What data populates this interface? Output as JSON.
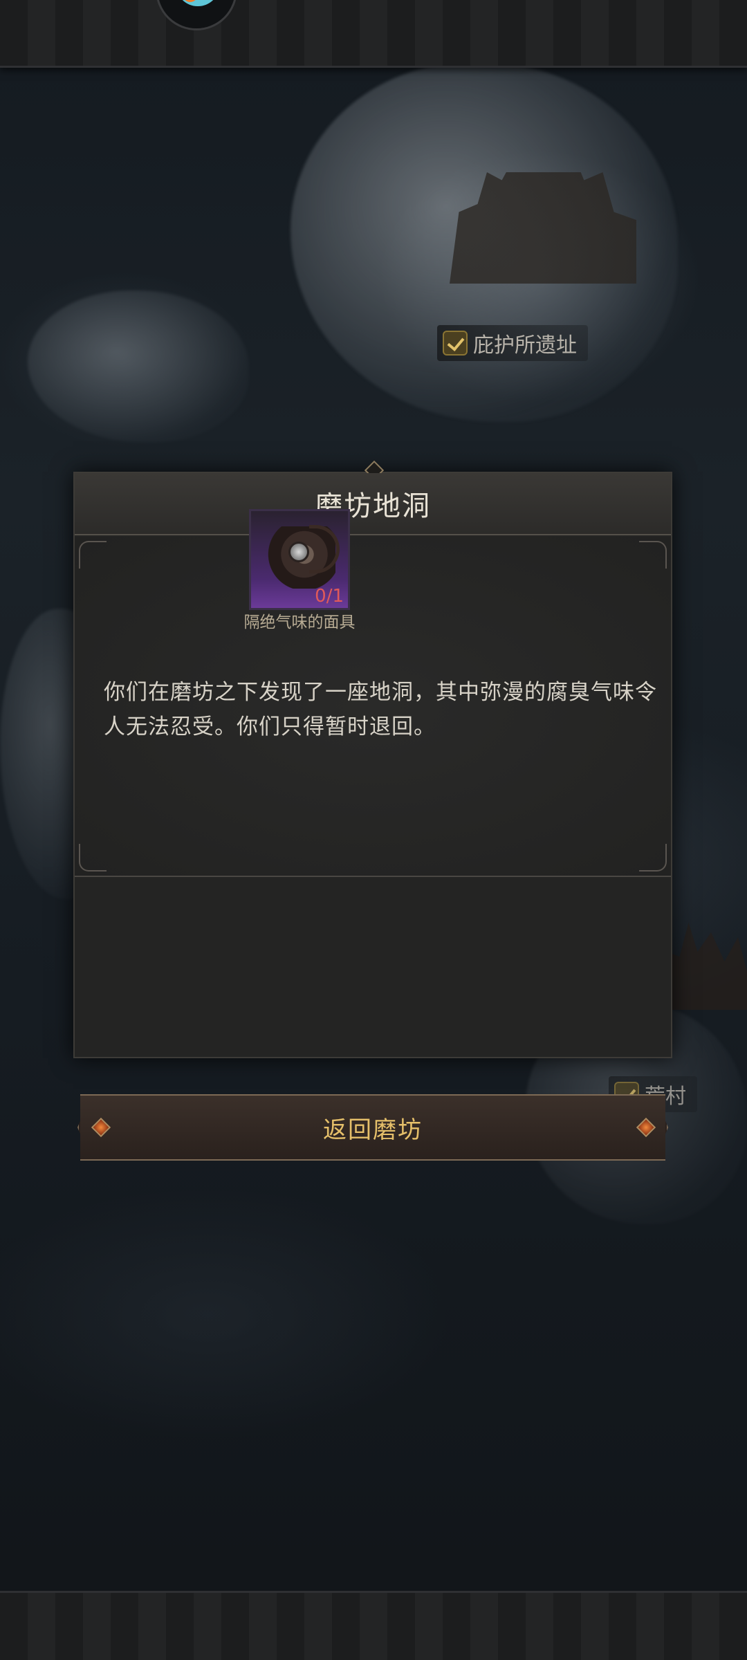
{
  "map": {
    "labels": [
      {
        "text": "庇护所遗址",
        "icon": "check-icon"
      },
      {
        "text": "荒村",
        "icon": "check-icon"
      }
    ]
  },
  "dialog": {
    "title": "磨坊地洞",
    "body_text": "你们在磨坊之下发现了一座地洞，其中弥漫的腐臭气味令人无法忍受。你们只得暂时退回。",
    "required_item": {
      "name": "隔绝气味的面具",
      "count": "0/1",
      "icon": "mask-icon",
      "rarity_color": "#6b3a98"
    }
  },
  "actions": {
    "return_label": "返回磨坊"
  },
  "colors": {
    "accent_gold": "#e6c06a",
    "count_red": "#e05a5a"
  }
}
